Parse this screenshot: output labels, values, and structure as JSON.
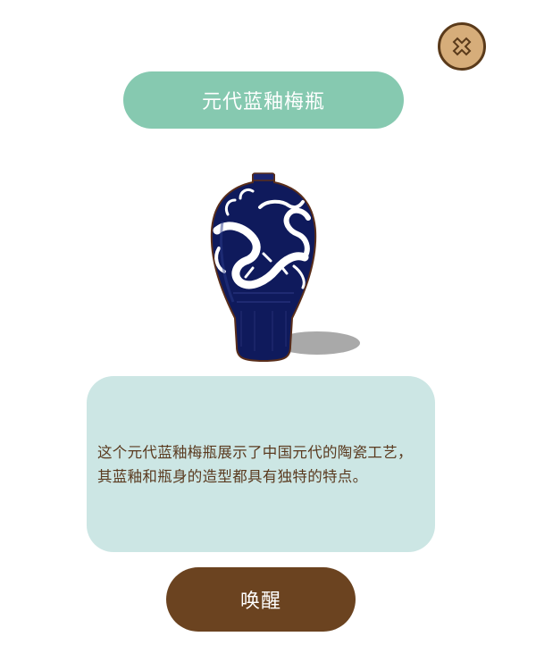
{
  "dialog": {
    "title": "元代蓝釉梅瓶",
    "description": "这个元代蓝釉梅瓶展示了中国元代的陶瓷工艺，其蓝釉和瓶身的造型都具有独特的特点。",
    "close_icon": "close-x-icon",
    "awaken_label": "唤醒"
  },
  "colors": {
    "title_pill_bg": "#86c9b0",
    "card_bg": "#cce6e4",
    "button_bg": "#6b4320",
    "close_bg": "#d6ad7a",
    "vase_glaze": "#0f1a5c"
  }
}
